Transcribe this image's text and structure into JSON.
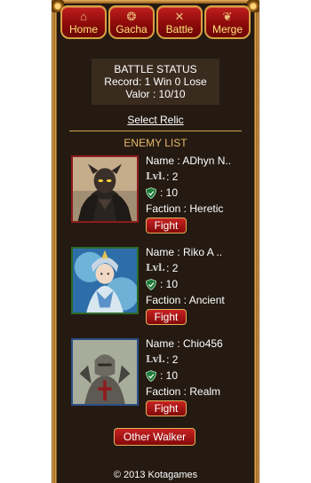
{
  "nav": {
    "items": [
      {
        "label": "Home",
        "icon": "house-icon"
      },
      {
        "label": "Gacha",
        "icon": "scroll-icon"
      },
      {
        "label": "Battle",
        "icon": "crossed-swords-icon"
      },
      {
        "label": "Merge",
        "icon": "merge-icon"
      }
    ]
  },
  "status": {
    "title": "BATTLE STATUS",
    "record": "Record: 1 Win 0 Lose",
    "valor": "Valor : 10/10"
  },
  "select_relic": "Select Relic",
  "enemy_list_title": "ENEMY LIST",
  "enemies": [
    {
      "name": "Name : ADhyn N..",
      "lvl_tag": "Lvl.",
      "level": ": 2",
      "valor": ": 10",
      "faction": "Faction : Heretic",
      "fight": "Fight"
    },
    {
      "name": "Name : Riko A ..",
      "lvl_tag": "Lvl.",
      "level": ": 2",
      "valor": ": 10",
      "faction": "Faction : Ancient",
      "fight": "Fight"
    },
    {
      "name": "Name : Chio456",
      "lvl_tag": "Lvl.",
      "level": ": 2",
      "valor": ": 10",
      "faction": "Faction : Realm",
      "fight": "Fight"
    }
  ],
  "other_walker": "Other Walker",
  "footer": "© 2013 Kotagames",
  "colors": {
    "frame_bg": "#241a12",
    "gold": "#d9a450",
    "button_red": "#a31313",
    "nav_text": "#ffe37a"
  }
}
